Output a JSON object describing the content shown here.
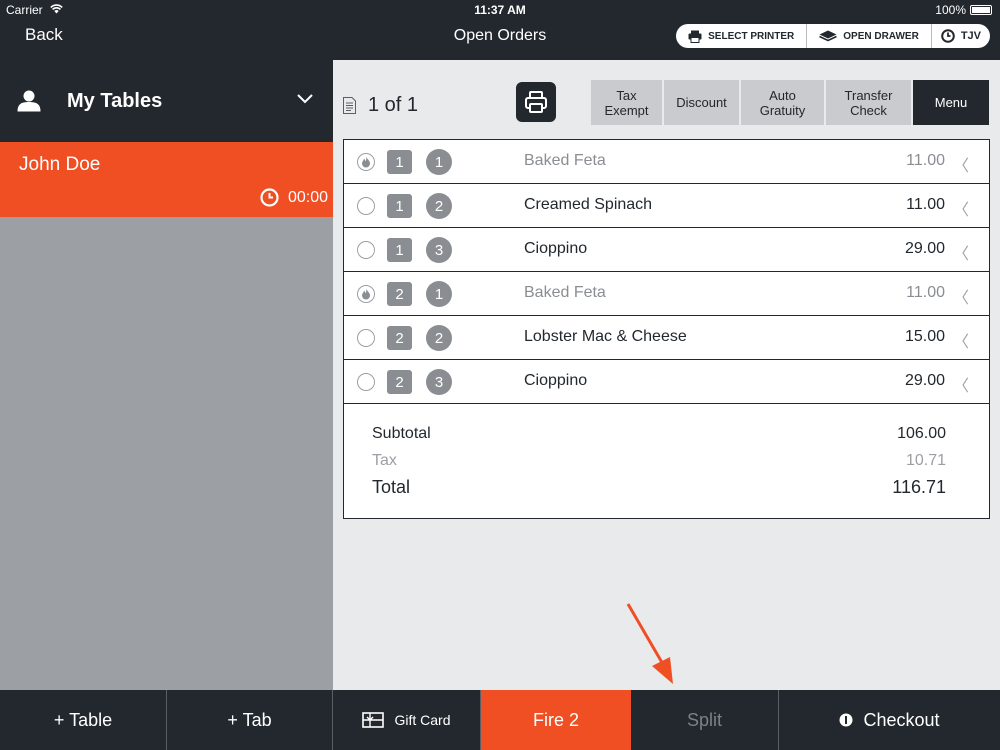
{
  "status_bar": {
    "carrier": "Carrier",
    "time": "11:37 AM",
    "battery": "100%"
  },
  "header": {
    "back_label": "Back",
    "title": "Open Orders",
    "actions": [
      {
        "label": "SELECT PRINTER",
        "icon": "printer-icon"
      },
      {
        "label": "OPEN DRAWER",
        "icon": "drawer-icon"
      },
      {
        "label": "TJV",
        "icon": "clock-icon"
      }
    ]
  },
  "sidebar": {
    "header_label": "My Tables",
    "tables": [
      {
        "name": "John Doe",
        "time": "00:00"
      }
    ]
  },
  "check": {
    "page_info": "1 of 1",
    "tools": [
      {
        "label": "Tax Exempt"
      },
      {
        "label": "Discount"
      },
      {
        "label": "Auto Gratuity"
      },
      {
        "label": "Transfer Check"
      },
      {
        "label": "Menu"
      }
    ],
    "items": [
      {
        "seat": "1",
        "course": "1",
        "name": "Baked Feta",
        "price": "11.00",
        "fired": true
      },
      {
        "seat": "1",
        "course": "2",
        "name": "Creamed Spinach",
        "price": "11.00",
        "fired": false
      },
      {
        "seat": "1",
        "course": "3",
        "name": "Cioppino",
        "price": "29.00",
        "fired": false
      },
      {
        "seat": "2",
        "course": "1",
        "name": "Baked Feta",
        "price": "11.00",
        "fired": true
      },
      {
        "seat": "2",
        "course": "2",
        "name": "Lobster Mac & Cheese",
        "price": "15.00",
        "fired": false
      },
      {
        "seat": "2",
        "course": "3",
        "name": "Cioppino",
        "price": "29.00",
        "fired": false
      }
    ],
    "totals": {
      "subtotal_label": "Subtotal",
      "subtotal_value": "106.00",
      "tax_label": "Tax",
      "tax_value": "10.71",
      "total_label": "Total",
      "total_value": "116.71"
    }
  },
  "bottom_bar": {
    "add_table": "+ Table",
    "add_tab": "+ Tab",
    "gift_card": "Gift Card",
    "fire": "Fire 2",
    "split": "Split",
    "checkout": "Checkout"
  },
  "colors": {
    "accent": "#f04e23",
    "dark": "#22282e",
    "panel_gray": "#9c9fa3"
  }
}
